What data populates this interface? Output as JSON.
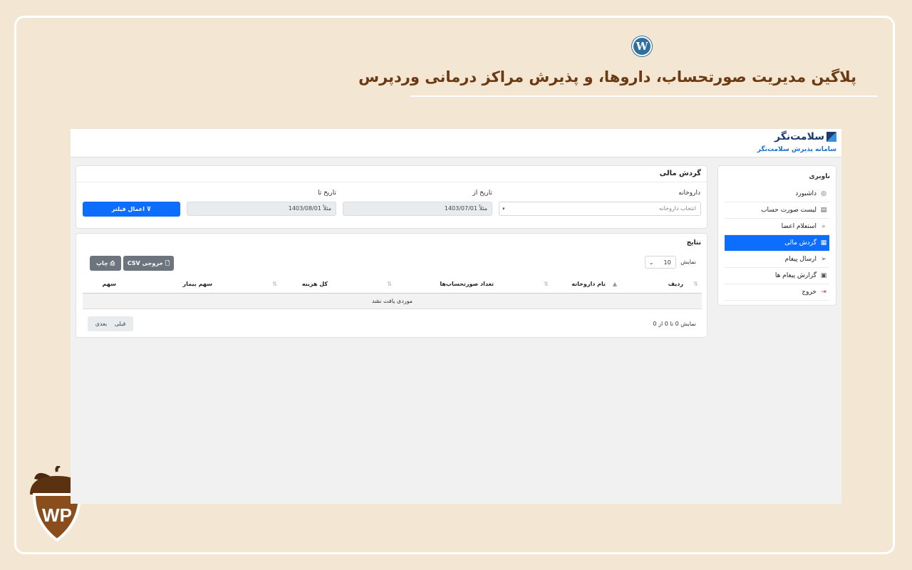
{
  "headline": "پلاگین مدیریت صورتحساب، داروها، و پذیرش مراکز درمانی وردپرس",
  "wp_logo": "W",
  "brand": {
    "name": "سلامت‌نگر",
    "subtitle": "سامانه پذیرش سلامت‌نگر"
  },
  "sidebar": {
    "title": "ناوبری",
    "items": [
      {
        "label": "داشبورد",
        "icon": "gauge-icon",
        "glyph": "◎"
      },
      {
        "label": "لیست صورت حساب",
        "icon": "invoice-icon",
        "glyph": "▤"
      },
      {
        "label": "استعلام اعضا",
        "icon": "search-icon",
        "glyph": "⌕"
      },
      {
        "label": "گردش مالی",
        "icon": "ledger-icon",
        "glyph": "▦",
        "active": true
      },
      {
        "label": "ارسال پیغام",
        "icon": "send-icon",
        "glyph": "➢"
      },
      {
        "label": "گزارش پیغام ها",
        "icon": "inbox-icon",
        "glyph": "▣"
      },
      {
        "label": "خروج",
        "icon": "logout-icon",
        "glyph": "⇥"
      }
    ]
  },
  "filter": {
    "title": "گردش مالی",
    "pharmacy_label": "داروخانه",
    "pharmacy_placeholder": "انتخاب داروخانه",
    "date_from_label": "تاریخ از",
    "date_from_value": "مثلاً 1403/07/01",
    "date_to_label": "تاریخ تا",
    "date_to_value": "مثلاً 1403/08/01",
    "apply_label": "⊽ اعمال فیلتر"
  },
  "results": {
    "title": "نتایج",
    "show_label": "نمایش",
    "page_length": "10",
    "csv_label": "خروجی CSV",
    "print_label": "چاپ",
    "columns": [
      "ردیف",
      "نام داروخانه",
      "تعداد صورتحساب‌ها",
      "کل هزینه",
      "سهم بیمار",
      "سهم داروخانه"
    ],
    "empty_text": "موردی یافت نشد",
    "info_text": "نمایش 0 تا 0 از 0",
    "prev_label": "قبلی",
    "next_label": "بعدی"
  },
  "colors": {
    "primary": "#0d6efd",
    "secondary": "#6c757d",
    "background": "#f3e6d2",
    "headline": "#6b3a12"
  }
}
